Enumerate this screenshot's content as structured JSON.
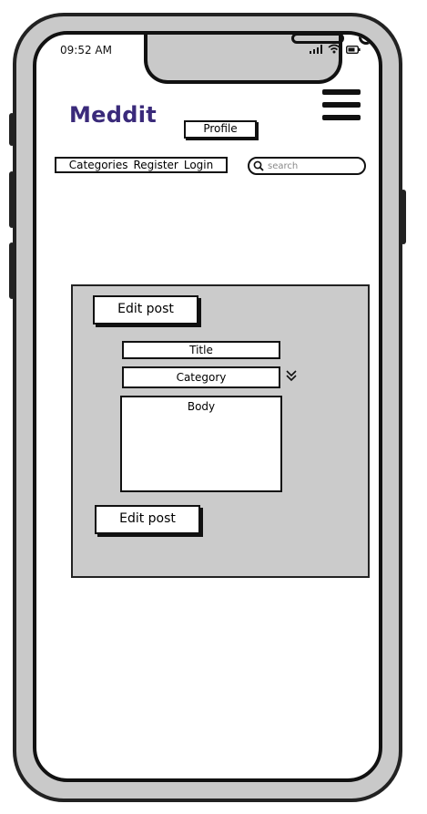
{
  "status_bar": {
    "time": "09:52 AM"
  },
  "header": {
    "logo": "Meddit",
    "profile_label": "Profile"
  },
  "nav": {
    "items": [
      "Categories",
      "Register",
      "Login"
    ]
  },
  "search": {
    "placeholder": "search"
  },
  "form": {
    "top_button_label": "Edit post",
    "title_placeholder": "Title",
    "category_placeholder": "Category",
    "body_placeholder": "Body",
    "bottom_button_label": "Edit post"
  },
  "colors": {
    "logo": "#3a2a7a",
    "panel": "#cbcbcb",
    "phone_frame": "#c9c9c9"
  }
}
